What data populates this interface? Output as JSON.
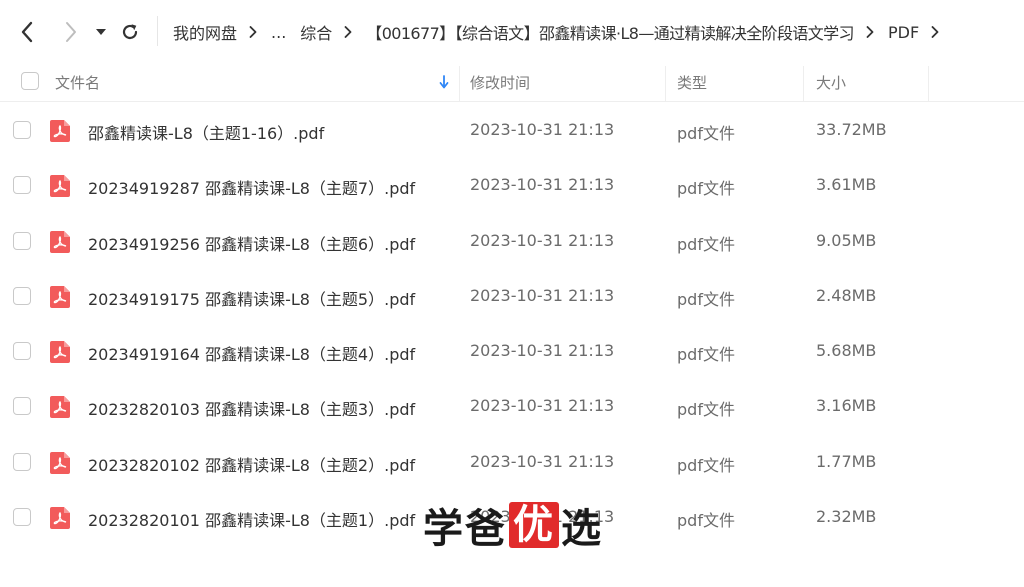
{
  "toolbar": {
    "back_icon": "chevron-left-icon",
    "forward_icon": "chevron-right-icon",
    "dropdown_icon": "caret-down-icon",
    "refresh_icon": "refresh-icon"
  },
  "breadcrumb": {
    "items": [
      "我的网盘",
      "...",
      "综合",
      "【001677】【综合语文】邵鑫精读课·L8—通过精读解决全阶段语文学习",
      "PDF"
    ]
  },
  "table": {
    "columns": {
      "name": "文件名",
      "modified": "修改时间",
      "type": "类型",
      "size": "大小"
    },
    "sort_icon": "sort-down-arrow-icon",
    "rows": [
      {
        "name": "邵鑫精读课-L8（主题1-16）.pdf",
        "modified": "2023-10-31 21:13",
        "type": "pdf文件",
        "size": "33.72MB"
      },
      {
        "name": "20234919287 邵鑫精读课-L8（主题7）.pdf",
        "modified": "2023-10-31 21:13",
        "type": "pdf文件",
        "size": "3.61MB"
      },
      {
        "name": "20234919256 邵鑫精读课-L8（主题6）.pdf",
        "modified": "2023-10-31 21:13",
        "type": "pdf文件",
        "size": "9.05MB"
      },
      {
        "name": "20234919175 邵鑫精读课-L8（主题5）.pdf",
        "modified": "2023-10-31 21:13",
        "type": "pdf文件",
        "size": "2.48MB"
      },
      {
        "name": "20234919164 邵鑫精读课-L8（主题4）.pdf",
        "modified": "2023-10-31 21:13",
        "type": "pdf文件",
        "size": "5.68MB"
      },
      {
        "name": "20232820103 邵鑫精读课-L8（主题3）.pdf",
        "modified": "2023-10-31 21:13",
        "type": "pdf文件",
        "size": "3.16MB"
      },
      {
        "name": "20232820102 邵鑫精读课-L8（主题2）.pdf",
        "modified": "2023-10-31 21:13",
        "type": "pdf文件",
        "size": "1.77MB"
      },
      {
        "name": "20232820101 邵鑫精读课-L8（主题1）.pdf",
        "modified": "2023-10-31 21:13",
        "type": "pdf文件",
        "size": "2.32MB"
      }
    ]
  },
  "watermark": {
    "part1": "学爸",
    "part2": "优",
    "part3": "选"
  },
  "colors": {
    "pdf_icon": "#f25b5b",
    "sort_arrow": "#2f86f6",
    "watermark_box": "#e12b2b"
  }
}
